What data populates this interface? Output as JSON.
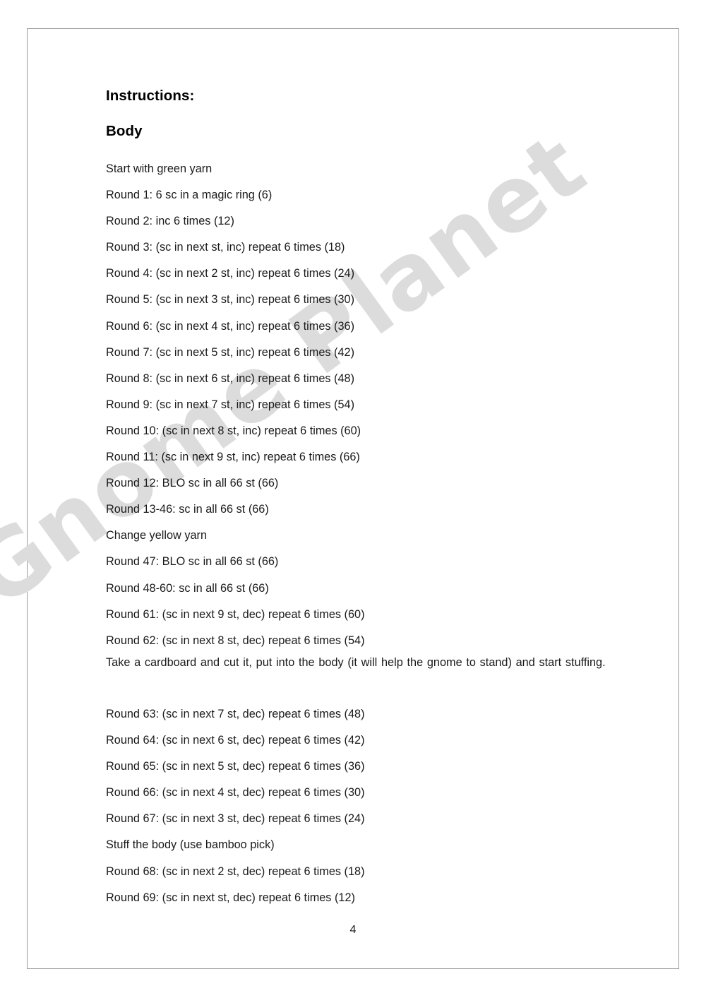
{
  "document": {
    "page_number": "4",
    "watermark_text": "Gnome Planet",
    "watermark_color": "#dcdcdc",
    "text_color": "#1a1a1a",
    "border_color": "#9a9a9a"
  },
  "headings": {
    "instructions": "Instructions:",
    "section": "Body"
  },
  "lines_part1": [
    "Start with green yarn",
    "Round 1: 6 sc in a magic ring (6)",
    "Round 2: inc 6 times (12)",
    "Round 3: (sc in next st, inc) repeat 6 times (18)",
    "Round 4: (sc in next 2 st, inc) repeat 6 times (24)",
    "Round 5: (sc in next 3 st, inc) repeat 6 times (30)",
    "Round 6: (sc in next 4 st, inc) repeat 6 times (36)",
    "Round 7: (sc in next 5 st, inc) repeat 6 times (42)",
    "Round 8: (sc in next 6 st, inc) repeat 6 times (48)",
    "Round 9: (sc in next 7 st, inc) repeat 6 times (54)",
    "Round 10: (sc in next 8 st, inc) repeat 6 times (60)",
    "Round 11: (sc in next 9 st, inc) repeat 6 times (66)",
    "Round 12: BLO sc in all 66 st (66)",
    "Round 13-46: sc in all 66 st (66)",
    "Change yellow yarn",
    "Round 47: BLO sc in all 66 st (66)",
    "Round 48-60: sc in all 66 st (66)",
    "Round 61: (sc in next 9 st, dec) repeat 6 times (60)",
    "Round 62: (sc in next 8 st, dec) repeat 6 times (54)"
  ],
  "paragraph": "Take a cardboard and cut it, put into the body (it will help the gnome to stand) and start stuffing.",
  "lines_part2": [
    "Round 63: (sc in next 7 st, dec) repeat 6 times (48)",
    "Round 64: (sc in next 6 st, dec) repeat 6 times (42)",
    "Round 65: (sc in next 5 st, dec) repeat 6 times (36)",
    "Round 66: (sc in next 4 st, dec) repeat 6 times (30)",
    "Round 67: (sc in next 3 st, dec) repeat 6 times (24)",
    "Stuff the body (use bamboo pick)",
    "Round 68: (sc in next 2 st, dec) repeat 6 times (18)",
    "Round 69: (sc in next st, dec) repeat 6 times (12)"
  ]
}
